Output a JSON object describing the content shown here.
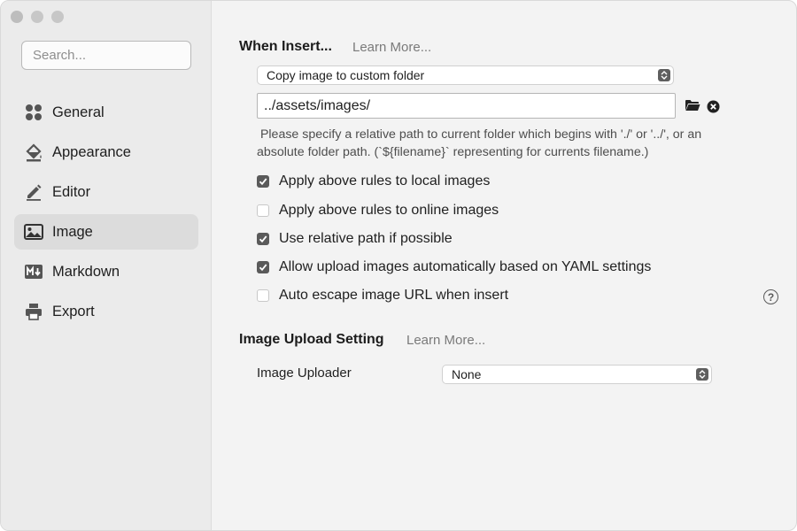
{
  "sidebar": {
    "search": {
      "placeholder": "Search..."
    },
    "items": [
      {
        "label": "General",
        "icon": "general-grid-icon"
      },
      {
        "label": "Appearance",
        "icon": "paint-bucket-icon"
      },
      {
        "label": "Editor",
        "icon": "pencil-icon"
      },
      {
        "label": "Image",
        "icon": "image-icon",
        "active": true
      },
      {
        "label": "Markdown",
        "icon": "markdown-icon"
      },
      {
        "label": "Export",
        "icon": "printer-icon"
      }
    ]
  },
  "when_insert": {
    "title": "When Insert...",
    "learn_more": "Learn More...",
    "action_select": "Copy image to custom folder",
    "path_value": "../assets/images/",
    "help_line1": " Please specify a relative path to current folder which begins with './' or '../', or an",
    "help_line2": "absolute folder path. (`${filename}` representing for currents filename.)",
    "options": [
      {
        "label": "Apply above rules to local images",
        "checked": true
      },
      {
        "label": "Apply above rules to online images",
        "checked": false
      },
      {
        "label": "Use relative path if possible",
        "checked": true
      },
      {
        "label": "Allow upload images automatically based on YAML settings",
        "checked": true
      },
      {
        "label": "Auto escape image URL when insert",
        "checked": false
      }
    ],
    "help_button": "?"
  },
  "upload": {
    "title": "Image Upload Setting",
    "learn_more": "Learn More...",
    "uploader_label": "Image Uploader",
    "uploader_value": "None"
  },
  "colors": {
    "sidebar_bg": "#ebebeb",
    "main_bg": "#f3f3f3",
    "active_item_bg": "#dcdcdc",
    "checkbox_checked": "#5a5a5a"
  }
}
